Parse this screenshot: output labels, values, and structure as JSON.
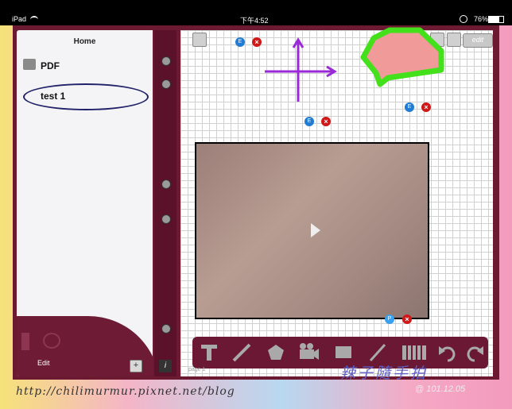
{
  "status_bar": {
    "carrier": "iPad",
    "time": "下午4:52",
    "battery": "76%"
  },
  "sidebar": {
    "title": "Home",
    "items": [
      {
        "label": "PDF",
        "icon": "folder-icon"
      },
      {
        "label": "test 1",
        "icon": "note-icon",
        "selected": true
      }
    ],
    "edit_label": "Edit",
    "add_label": "+"
  },
  "spine": {
    "info_label": "i"
  },
  "canvas": {
    "edit_button": "edit",
    "page_label": "page 1",
    "badge_e": "E",
    "badge_x": "×",
    "badge_p": "P"
  },
  "toolbar": {
    "tools": [
      "text-tool-icon",
      "pen-tool-icon",
      "shape-tool-icon",
      "video-camera-icon",
      "rectangle-tool-icon",
      "pencil-tool-icon",
      "piano-icon",
      "undo-icon",
      "redo-icon"
    ]
  },
  "colors": {
    "frame": "#6b1a32",
    "arrow_purple": "#9a2ad8",
    "shape_green": "#44e01c",
    "shape_fill": "#f09a9a",
    "badge_blue": "#1f7bd4",
    "badge_red": "#d01818"
  },
  "watermark": {
    "url": "http://chilimurmur.pixnet.net/blog",
    "signature": "辣子隨手拍",
    "date": "@ 101.12.05"
  }
}
